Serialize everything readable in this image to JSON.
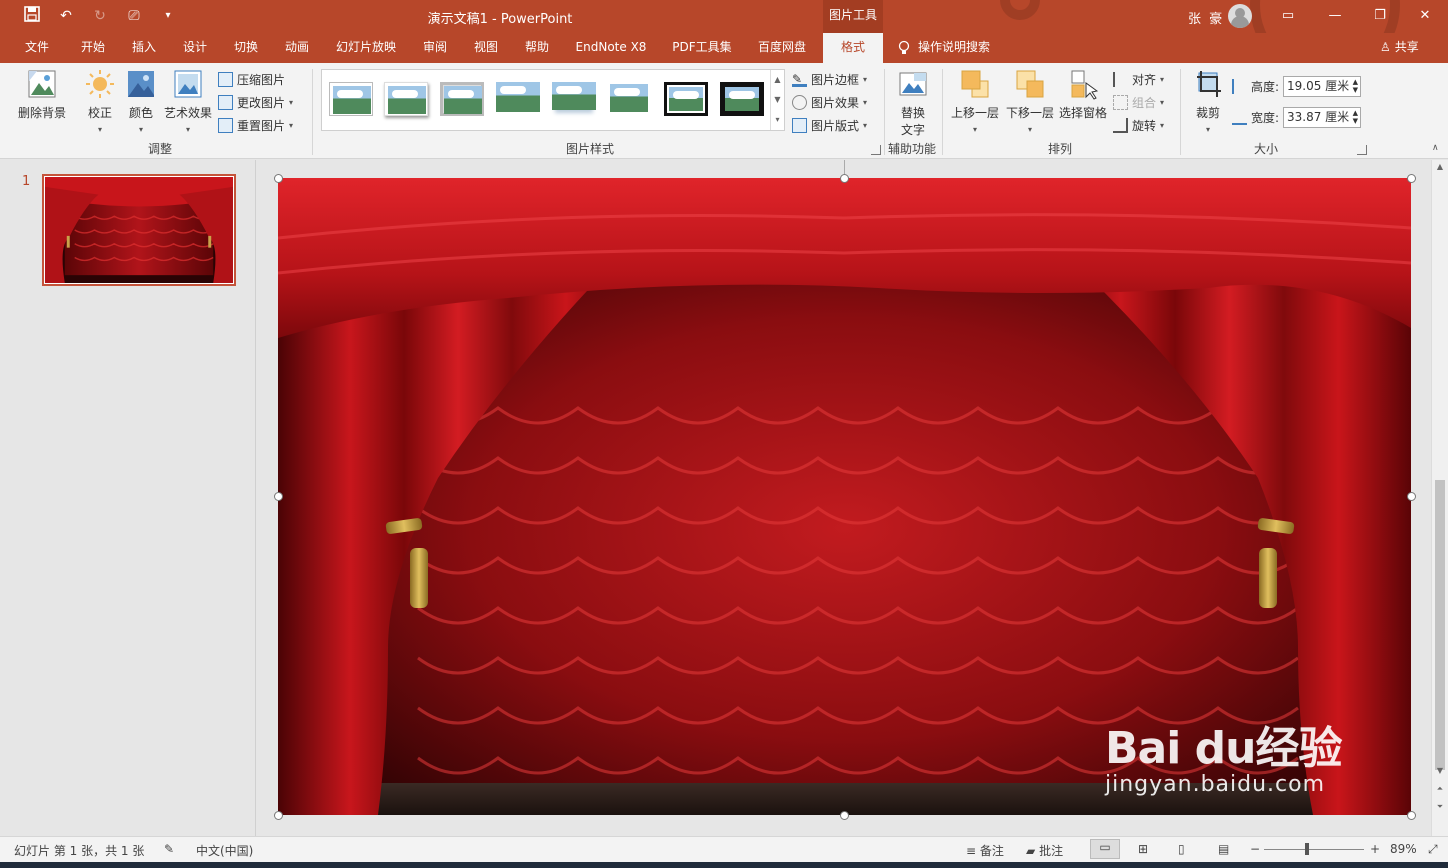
{
  "window": {
    "title": "演示文稿1 - PowerPoint",
    "context_tool": "图片工具",
    "user": "张 豪"
  },
  "tabs": [
    {
      "label": "文件"
    },
    {
      "label": "开始"
    },
    {
      "label": "插入"
    },
    {
      "label": "设计"
    },
    {
      "label": "切换"
    },
    {
      "label": "动画"
    },
    {
      "label": "幻灯片放映"
    },
    {
      "label": "审阅"
    },
    {
      "label": "视图"
    },
    {
      "label": "帮助"
    },
    {
      "label": "EndNote X8"
    },
    {
      "label": "PDF工具集"
    },
    {
      "label": "百度网盘"
    },
    {
      "label": "格式",
      "active": true
    }
  ],
  "tell_me": "操作说明搜索",
  "share": "共享",
  "ribbon": {
    "adjust": {
      "remove_bg": "删除背景",
      "correct": "校正",
      "color": "颜色",
      "artistic": "艺术效果",
      "compress": "压缩图片",
      "change": "更改图片",
      "reset": "重置图片",
      "label": "调整"
    },
    "styles": {
      "border": "图片边框",
      "effects": "图片效果",
      "layout": "图片版式",
      "label": "图片样式"
    },
    "accessibility": {
      "alt_text_1": "替换",
      "alt_text_2": "文字",
      "label": "辅助功能"
    },
    "arrange": {
      "bring_forward": "上移一层",
      "send_backward": "下移一层",
      "selection_pane": "选择窗格",
      "align": "对齐",
      "group": "组合",
      "rotate": "旋转",
      "label": "排列"
    },
    "size": {
      "crop": "裁剪",
      "height_label": "高度:",
      "height_value": "19.05 厘米",
      "width_label": "宽度:",
      "width_value": "33.87 厘米",
      "label": "大小"
    }
  },
  "slides": [
    {
      "number": "1"
    }
  ],
  "status": {
    "slide_info": "幻灯片 第 1 张，共 1 张",
    "language": "中文(中国)",
    "notes": "备注",
    "comments": "批注",
    "zoom": "89%",
    "zoom_level": 0.89
  },
  "watermark": {
    "brand": "Bai du经验",
    "url": "jingyan.baidu.com"
  },
  "colors": {
    "accent": "#b7472a",
    "curtain": "#c0141a"
  }
}
